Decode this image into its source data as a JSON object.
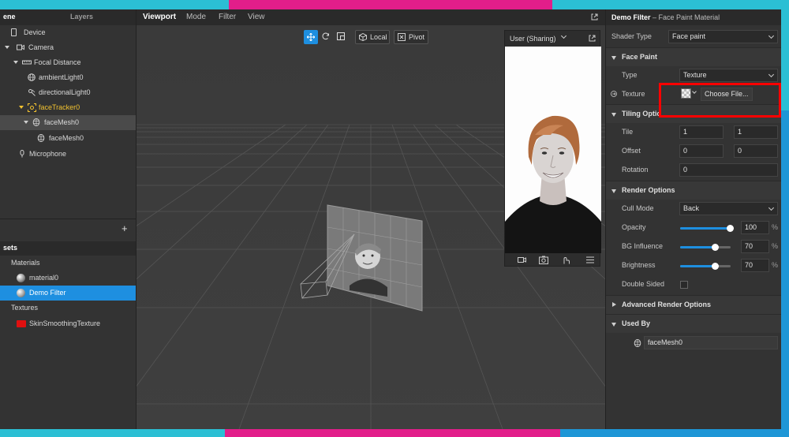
{
  "colors": {
    "accent": "#1e8fe0",
    "frame_cyan": "#2bbfd4",
    "frame_magenta": "#e21e8a",
    "frame_blue": "#1e96d6",
    "highlight_red": "#ff0000",
    "selected_yellow": "#f2c230"
  },
  "left_panel": {
    "tabs": [
      "ene",
      "Layers"
    ],
    "scene_items": [
      {
        "label": "Device",
        "icon": "square-icon"
      },
      {
        "label": "Camera",
        "icon": "camera-icon"
      },
      {
        "label": "Focal Distance",
        "icon": "ruler-icon"
      },
      {
        "label": "ambientLight0",
        "icon": "globe-icon"
      },
      {
        "label": "directionalLight0",
        "icon": "light-icon"
      },
      {
        "label": "faceTracker0",
        "icon": "face-tracker-icon"
      },
      {
        "label": "faceMesh0",
        "icon": "mesh-icon"
      },
      {
        "label": "faceMesh0",
        "icon": "mesh-icon"
      },
      {
        "label": "Microphone",
        "icon": "microphone-icon"
      }
    ],
    "add_button": "+",
    "assets_title": "sets",
    "assets": [
      {
        "label": "Materials",
        "type": "group"
      },
      {
        "label": "material0",
        "type": "material"
      },
      {
        "label": "Demo Filter",
        "type": "material"
      },
      {
        "label": "Textures",
        "type": "group"
      },
      {
        "label": "SkinSmoothingTexture",
        "type": "texture"
      }
    ]
  },
  "viewport": {
    "menu": [
      "Viewport",
      "Mode",
      "Filter",
      "View"
    ],
    "toolbar": {
      "local": "Local",
      "pivot": "Pivot"
    },
    "preview": {
      "title": "User (Sharing)"
    }
  },
  "right_panel": {
    "title": "Demo Filter",
    "subtitle": "– Face Paint Material",
    "shader_type_label": "Shader Type",
    "shader_type_value": "Face paint",
    "face_paint": {
      "section": "Face Paint",
      "type_label": "Type",
      "type_value": "Texture",
      "texture_label": "Texture",
      "choose_file": "Choose File..."
    },
    "tiling": {
      "section": "Tiling Optio",
      "tile_label": "Tile",
      "tile_x": "1",
      "tile_y": "1",
      "offset_label": "Offset",
      "offset_x": "0",
      "offset_y": "0",
      "rotation_label": "Rotation",
      "rotation_value": "0"
    },
    "render": {
      "section": "Render Options",
      "cull_label": "Cull Mode",
      "cull_value": "Back",
      "opacity_label": "Opacity",
      "opacity_value": "100",
      "opacity_fraction": 1.0,
      "bg_label": "BG Influence",
      "bg_value": "70",
      "bg_fraction": 0.7,
      "brightness_label": "Brightness",
      "brightness_value": "70",
      "brightness_fraction": 0.7,
      "double_sided_label": "Double Sided",
      "pct_symbol": "%"
    },
    "advanced": {
      "section": "Advanced Render Options"
    },
    "used_by": {
      "section": "Used By",
      "item": "faceMesh0"
    }
  }
}
